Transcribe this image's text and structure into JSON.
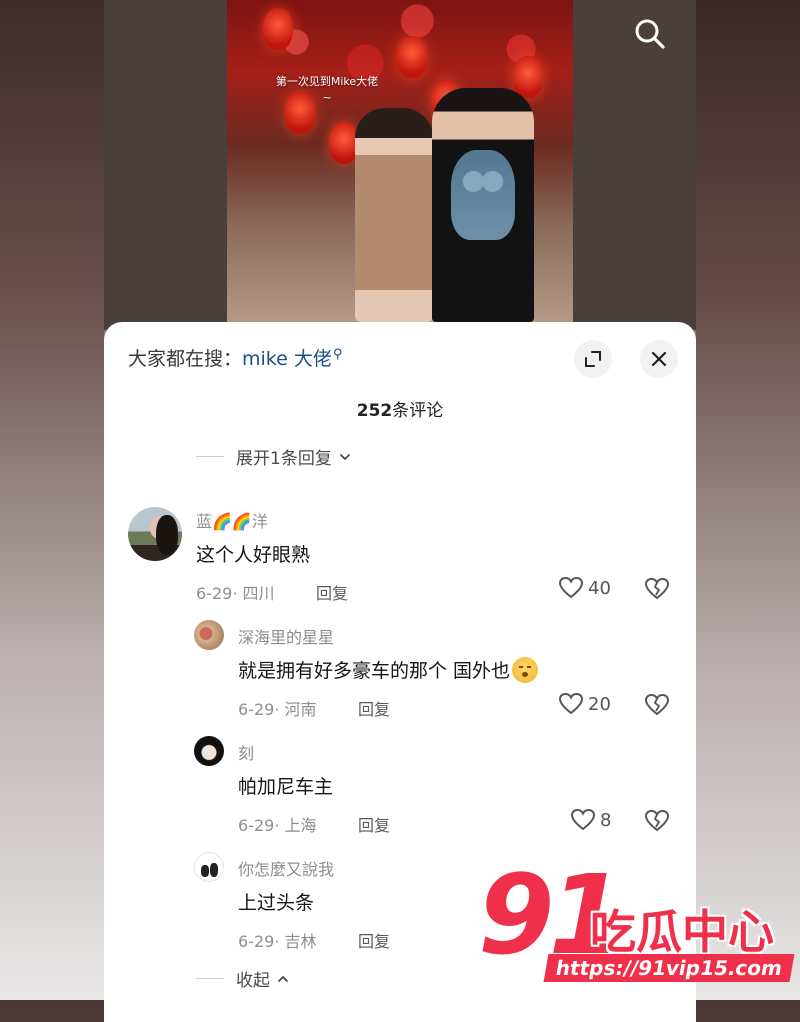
{
  "video": {
    "caption_line1": "第一次见到Mike大佬",
    "caption_line2": "~"
  },
  "search_bar": {
    "label": "大家都在搜：",
    "keyword": "mike 大佬"
  },
  "comments_header": {
    "count": "252",
    "count_suffix": "条评论"
  },
  "expand_replies": {
    "label": "展开1条回复"
  },
  "collapse": {
    "label": "收起"
  },
  "comments": [
    {
      "username": "蓝🌈🌈洋",
      "text": "这个人好眼熟",
      "date": "6-29",
      "location": "四川",
      "reply_label": "回复",
      "likes": "40"
    },
    {
      "username": "深海里的星星",
      "text": "就是拥有好多豪车的那个 国外也",
      "date": "6-29",
      "location": "河南",
      "reply_label": "回复",
      "likes": "20"
    },
    {
      "username": "刻",
      "text": "帕加尼车主",
      "date": "6-29",
      "location": "上海",
      "reply_label": "回复",
      "likes": "8"
    },
    {
      "username": "你怎麼又說我",
      "text": "上过头条",
      "date": "6-29",
      "location": "吉林",
      "reply_label": "回复",
      "likes": ""
    }
  ],
  "watermark": {
    "number": "91",
    "name": "吃瓜中心",
    "url": "https://91vip15.com"
  },
  "colors": {
    "accent": "#f0304a",
    "keyword": "#1d4e89",
    "meta_gray": "#8e8e8e"
  },
  "icons": [
    "search-icon",
    "expand-icon",
    "close-icon",
    "chevron-down-icon",
    "chevron-up-icon",
    "heart-icon",
    "broken-heart-icon"
  ]
}
